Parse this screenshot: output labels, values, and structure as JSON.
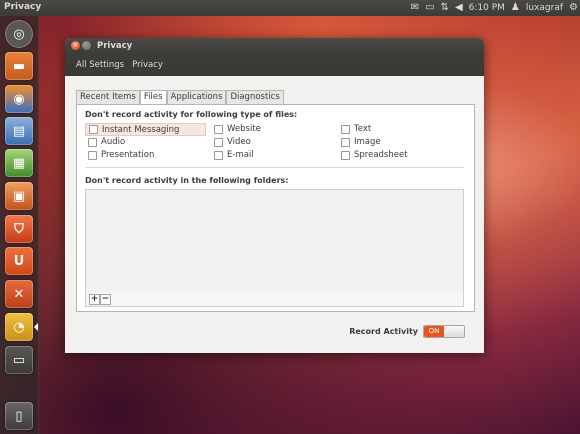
{
  "top_panel": {
    "title": "Privacy",
    "time": "6:10 PM",
    "user": "luxagraf"
  },
  "window": {
    "title": "Privacy",
    "breadcrumb": [
      "All Settings",
      "Privacy"
    ]
  },
  "tabs": [
    {
      "label": "Recent Items",
      "active": false
    },
    {
      "label": "Files",
      "active": true
    },
    {
      "label": "Applications",
      "active": false
    },
    {
      "label": "Diagnostics",
      "active": false
    }
  ],
  "files": {
    "types_heading": "Don't record activity for following type of files:",
    "types": [
      {
        "label": "Instant Messaging",
        "checked": false
      },
      {
        "label": "Audio",
        "checked": false
      },
      {
        "label": "Presentation",
        "checked": false
      },
      {
        "label": "Website",
        "checked": false
      },
      {
        "label": "Video",
        "checked": false
      },
      {
        "label": "E-mail",
        "checked": false
      },
      {
        "label": "Text",
        "checked": false
      },
      {
        "label": "Image",
        "checked": false
      },
      {
        "label": "Spreadsheet",
        "checked": false
      }
    ],
    "folders_heading": "Don't record activity in the following folders:",
    "add_label": "+",
    "remove_label": "−"
  },
  "record": {
    "label": "Record Activity",
    "state": "ON"
  },
  "colors": {
    "accent": "#e95420",
    "panel": "#3c3b37"
  }
}
